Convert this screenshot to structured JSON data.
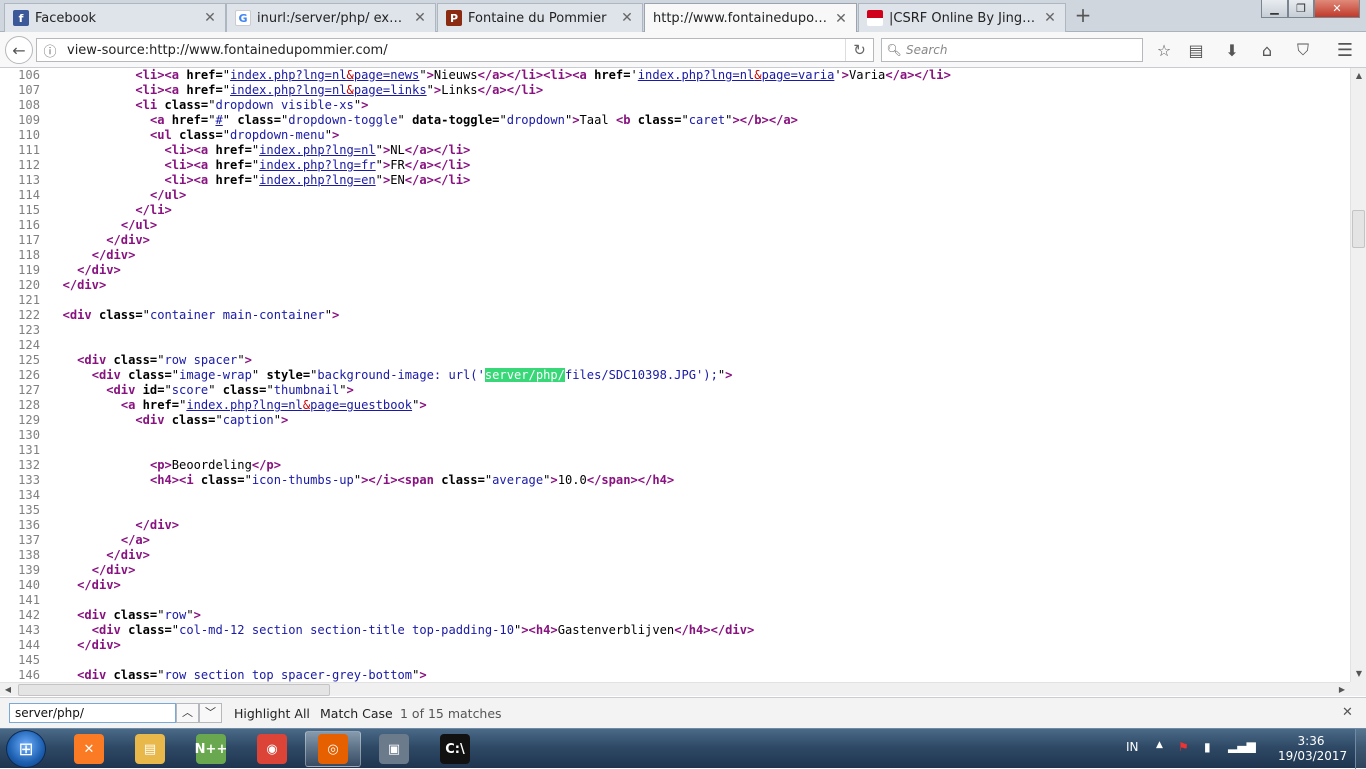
{
  "tabs": [
    {
      "title": "Facebook",
      "favicon": "facebook-icon",
      "color": "#3b5998",
      "glyph": "f",
      "active": false
    },
    {
      "title": "inurl:/server/php/ ext:jpg si...",
      "favicon": "google-icon",
      "color": "#ffffff",
      "glyph": "G",
      "active": false
    },
    {
      "title": "Fontaine du Pommier",
      "favicon": "site-icon",
      "color": "#8b2c12",
      "glyph": "P",
      "active": false
    },
    {
      "title": "http://www.fontainedupommi...",
      "favicon": "",
      "color": "",
      "glyph": "",
      "active": true
    },
    {
      "title": "|CSRF Online By Jingklong|",
      "favicon": "flag-icon",
      "color": "#d0021b",
      "glyph": "",
      "active": false
    }
  ],
  "nav": {
    "url": "view-source:http://www.fontainedupommier.com/",
    "search_placeholder": "Search"
  },
  "source_lines": [
    {
      "n": "106",
      "html": "            <span class=\"tg\">&lt;li&gt;&lt;a</span> <span class=\"an\">href=</span>\"<span class=\"lk\">index.php?lng=nl<span class=\"en\">&amp;</span>page=news</span>\"<span class=\"tg\">&gt;</span>Nieuws<span class=\"tg\">&lt;/a&gt;&lt;/li&gt;&lt;li&gt;&lt;a</span> <span class=\"an\">href=</span>'<span class=\"lk\">index.php?lng=nl<span class=\"en\">&amp;</span>page=varia</span>'<span class=\"tg\">&gt;</span>Varia<span class=\"tg\">&lt;/a&gt;&lt;/li&gt;</span>"
    },
    {
      "n": "107",
      "html": "            <span class=\"tg\">&lt;li&gt;&lt;a</span> <span class=\"an\">href=</span>\"<span class=\"lk\">index.php?lng=nl<span class=\"en\">&amp;</span>page=links</span>\"<span class=\"tg\">&gt;</span>Links<span class=\"tg\">&lt;/a&gt;&lt;/li&gt;</span>"
    },
    {
      "n": "108",
      "html": "            <span class=\"tg\">&lt;li</span> <span class=\"an\">class=</span>\"<span class=\"av\">dropdown visible-xs</span>\"<span class=\"tg\">&gt;</span>"
    },
    {
      "n": "109",
      "html": "              <span class=\"tg\">&lt;a</span> <span class=\"an\">href=</span>\"<span class=\"lk\">#</span>\" <span class=\"an\">class=</span>\"<span class=\"av\">dropdown-toggle</span>\" <span class=\"an\">data-toggle=</span>\"<span class=\"av\">dropdown</span>\"<span class=\"tg\">&gt;</span>Taal <span class=\"tg\">&lt;b</span> <span class=\"an\">class=</span>\"<span class=\"av\">caret</span>\"<span class=\"tg\">&gt;&lt;/b&gt;&lt;/a&gt;</span>"
    },
    {
      "n": "110",
      "html": "              <span class=\"tg\">&lt;ul</span> <span class=\"an\">class=</span>\"<span class=\"av\">dropdown-menu</span>\"<span class=\"tg\">&gt;</span>"
    },
    {
      "n": "111",
      "html": "                <span class=\"tg\">&lt;li&gt;&lt;a</span> <span class=\"an\">href=</span>\"<span class=\"lk\">index.php?lng=nl</span>\"<span class=\"tg\">&gt;</span>NL<span class=\"tg\">&lt;/a&gt;&lt;/li&gt;</span>"
    },
    {
      "n": "112",
      "html": "                <span class=\"tg\">&lt;li&gt;&lt;a</span> <span class=\"an\">href=</span>\"<span class=\"lk\">index.php?lng=fr</span>\"<span class=\"tg\">&gt;</span>FR<span class=\"tg\">&lt;/a&gt;&lt;/li&gt;</span>"
    },
    {
      "n": "113",
      "html": "                <span class=\"tg\">&lt;li&gt;&lt;a</span> <span class=\"an\">href=</span>\"<span class=\"lk\">index.php?lng=en</span>\"<span class=\"tg\">&gt;</span>EN<span class=\"tg\">&lt;/a&gt;&lt;/li&gt;</span>"
    },
    {
      "n": "114",
      "html": "              <span class=\"tg\">&lt;/ul&gt;</span>"
    },
    {
      "n": "115",
      "html": "            <span class=\"tg\">&lt;/li&gt;</span>"
    },
    {
      "n": "116",
      "html": "          <span class=\"tg\">&lt;/ul&gt;</span>"
    },
    {
      "n": "117",
      "html": "        <span class=\"tg\">&lt;/div&gt;</span>"
    },
    {
      "n": "118",
      "html": "      <span class=\"tg\">&lt;/div&gt;</span>"
    },
    {
      "n": "119",
      "html": "    <span class=\"tg\">&lt;/div&gt;</span>"
    },
    {
      "n": "120",
      "html": "  <span class=\"tg\">&lt;/div&gt;</span>"
    },
    {
      "n": "121",
      "html": ""
    },
    {
      "n": "122",
      "html": "  <span class=\"tg\">&lt;div</span> <span class=\"an\">class=</span>\"<span class=\"av\">container main-container</span>\"<span class=\"tg\">&gt;</span>"
    },
    {
      "n": "123",
      "html": ""
    },
    {
      "n": "124",
      "html": ""
    },
    {
      "n": "125",
      "html": "    <span class=\"tg\">&lt;div</span> <span class=\"an\">class=</span>\"<span class=\"av\">row spacer</span>\"<span class=\"tg\">&gt;</span>"
    },
    {
      "n": "126",
      "html": "      <span class=\"tg\">&lt;div</span> <span class=\"an\">class=</span>\"<span class=\"av\">image-wrap</span>\" <span class=\"an\">style=</span>\"<span class=\"av\">background-image: url('<span class=\"hl\">server/php/</span>files/SDC10398.JPG');</span>\"<span class=\"tg\">&gt;</span>"
    },
    {
      "n": "127",
      "html": "        <span class=\"tg\">&lt;div</span> <span class=\"an\">id=</span>\"<span class=\"av\">score</span>\" <span class=\"an\">class=</span>\"<span class=\"av\">thumbnail</span>\"<span class=\"tg\">&gt;</span>"
    },
    {
      "n": "128",
      "html": "          <span class=\"tg\">&lt;a</span> <span class=\"an\">href=</span>\"<span class=\"lk\">index.php?lng=nl<span class=\"en\">&amp;</span>page=guestbook</span>\"<span class=\"tg\">&gt;</span>"
    },
    {
      "n": "129",
      "html": "            <span class=\"tg\">&lt;div</span> <span class=\"an\">class=</span>\"<span class=\"av\">caption</span>\"<span class=\"tg\">&gt;</span>"
    },
    {
      "n": "130",
      "html": ""
    },
    {
      "n": "131",
      "html": ""
    },
    {
      "n": "132",
      "html": "              <span class=\"tg\">&lt;p&gt;</span>Beoordeling<span class=\"tg\">&lt;/p&gt;</span>"
    },
    {
      "n": "133",
      "html": "              <span class=\"tg\">&lt;h4&gt;&lt;i</span> <span class=\"an\">class=</span>\"<span class=\"av\">icon-thumbs-up</span>\"<span class=\"tg\">&gt;&lt;/i&gt;&lt;span</span> <span class=\"an\">class=</span>\"<span class=\"av\">average</span>\"<span class=\"tg\">&gt;</span>10.0<span class=\"tg\">&lt;/span&gt;&lt;/h4&gt;</span>"
    },
    {
      "n": "134",
      "html": ""
    },
    {
      "n": "135",
      "html": ""
    },
    {
      "n": "136",
      "html": "            <span class=\"tg\">&lt;/div&gt;</span>"
    },
    {
      "n": "137",
      "html": "          <span class=\"tg\">&lt;/a&gt;</span>"
    },
    {
      "n": "138",
      "html": "        <span class=\"tg\">&lt;/div&gt;</span>"
    },
    {
      "n": "139",
      "html": "      <span class=\"tg\">&lt;/div&gt;</span>"
    },
    {
      "n": "140",
      "html": "    <span class=\"tg\">&lt;/div&gt;</span>"
    },
    {
      "n": "141",
      "html": ""
    },
    {
      "n": "142",
      "html": "    <span class=\"tg\">&lt;div</span> <span class=\"an\">class=</span>\"<span class=\"av\">row</span>\"<span class=\"tg\">&gt;</span>"
    },
    {
      "n": "143",
      "html": "      <span class=\"tg\">&lt;div</span> <span class=\"an\">class=</span>\"<span class=\"av\">col-md-12 section section-title top-padding-10</span>\"<span class=\"tg\">&gt;&lt;h4&gt;</span>Gastenverblijven<span class=\"tg\">&lt;/h4&gt;&lt;/div&gt;</span>"
    },
    {
      "n": "144",
      "html": "    <span class=\"tg\">&lt;/div&gt;</span>"
    },
    {
      "n": "145",
      "html": ""
    },
    {
      "n": "146",
      "html": "    <span class=\"tg\">&lt;div</span> <span class=\"an\">class=</span>\"<span class=\"av\">row section top spacer-grey-bottom</span>\"<span class=\"tg\">&gt;</span>"
    }
  ],
  "findbar": {
    "query": "server/php/",
    "highlight_all": "Highlight All",
    "match_case": "Match Case",
    "status": "1 of 15 matches"
  },
  "taskbar": {
    "items": [
      {
        "name": "xampp-icon",
        "color": "#fb7a24",
        "glyph": "✕",
        "active": false
      },
      {
        "name": "file-explorer-icon",
        "color": "#e8b84a",
        "glyph": "▤",
        "active": false
      },
      {
        "name": "notepad-plus-icon",
        "color": "#6aa84f",
        "glyph": "N++",
        "active": false
      },
      {
        "name": "chrome-icon",
        "color": "#db4437",
        "glyph": "◉",
        "active": false
      },
      {
        "name": "firefox-icon",
        "color": "#e66000",
        "glyph": "◎",
        "active": true
      },
      {
        "name": "vm-terminal-icon",
        "color": "#6b7b8c",
        "glyph": "▣",
        "active": false
      },
      {
        "name": "cmd-icon",
        "color": "#111111",
        "glyph": "C:\\",
        "active": false
      }
    ],
    "language": "IN",
    "time": "3:36",
    "date": "19/03/2017"
  }
}
